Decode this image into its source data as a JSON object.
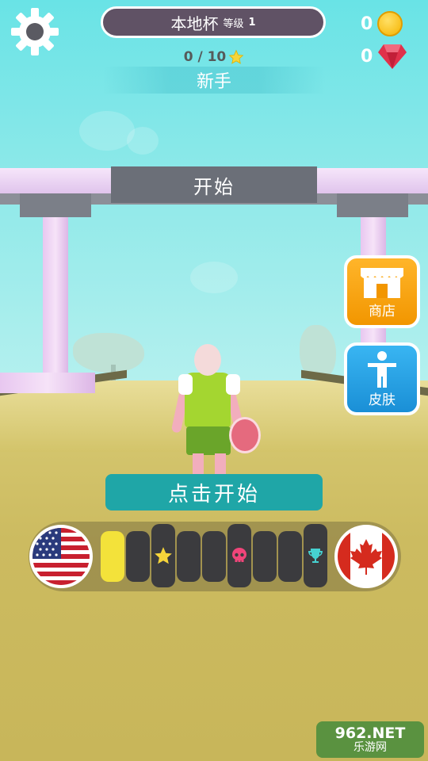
{
  "header": {
    "cup_name": "本地杯",
    "level_label": "等级",
    "level_value": "1",
    "stars_progress": "0 / 10",
    "rank": "新手"
  },
  "currency": {
    "coins": "0",
    "gems": "0"
  },
  "scene": {
    "gate_sign": "开始"
  },
  "side_buttons": {
    "shop": "商店",
    "skins": "皮肤"
  },
  "tap_to_start": "点击开始",
  "progress": {
    "from_flag": "usa-flag",
    "to_flag": "canada-flag",
    "segments_total": 9,
    "segments_completed": 1,
    "milestones": [
      "star-icon",
      "skull-icon",
      "trophy-icon"
    ]
  },
  "watermark": {
    "site": "962.NET",
    "name": "乐游网"
  },
  "colors": {
    "accent_teal": "#1fa6a7",
    "shop_orange": "#f29600",
    "skin_blue": "#1a8fd6",
    "progress_yellow": "#f3e23a",
    "gem_red": "#e0314b"
  }
}
